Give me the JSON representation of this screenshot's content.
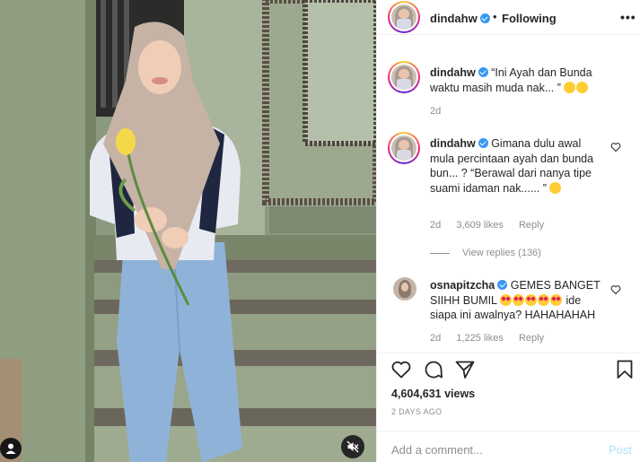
{
  "post": {
    "author": "dindahw",
    "follow_status": "Following",
    "more_label": "•••",
    "dot": "•"
  },
  "comments": [
    {
      "username": "dindahw",
      "text": "“Ini Ayah dan Bunda waktu masih muda nak... ”",
      "age": "2d",
      "likes": "",
      "reply": ""
    },
    {
      "username": "dindahw",
      "text": "Gimana dulu awal mula percintaan ayah dan bunda bun... ? “Berawal dari nanya tipe suami idaman nak...... ”",
      "age": "2d",
      "likes": "3,609 likes",
      "reply": "Reply",
      "view_replies": "View replies (136)"
    },
    {
      "username": "osnapitzcha",
      "text_before": "GEMES BANGET SIIHH BUMIL",
      "text_after": "ide siapa ini awalnya? HAHAHAHAH",
      "age": "2d",
      "likes": "1,225 likes",
      "reply": "Reply"
    }
  ],
  "stats": {
    "views": "4,604,631 views",
    "posted_ago": "2 DAYS AGO"
  },
  "composer": {
    "placeholder": "Add a comment...",
    "post_label": "Post"
  },
  "colors": {
    "verified": "#3897f0",
    "muted_text": "#8e8e8e",
    "post_button_disabled": "#b2dffc"
  },
  "icons": [
    "verified-badge-icon",
    "more-options-icon",
    "heart-icon",
    "comment-icon",
    "share-icon",
    "bookmark-icon",
    "user-tag-icon",
    "mute-icon"
  ]
}
